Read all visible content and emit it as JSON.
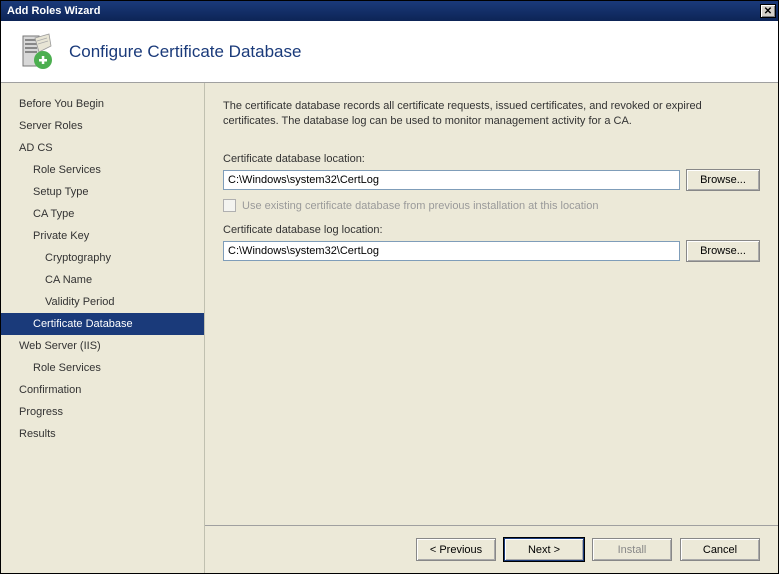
{
  "window": {
    "title": "Add Roles Wizard"
  },
  "header": {
    "page_title": "Configure Certificate Database"
  },
  "sidebar": {
    "items": [
      {
        "label": "Before You Begin",
        "indent": 0,
        "selected": false
      },
      {
        "label": "Server Roles",
        "indent": 0,
        "selected": false
      },
      {
        "label": "AD CS",
        "indent": 0,
        "selected": false
      },
      {
        "label": "Role Services",
        "indent": 1,
        "selected": false
      },
      {
        "label": "Setup Type",
        "indent": 1,
        "selected": false
      },
      {
        "label": "CA Type",
        "indent": 1,
        "selected": false
      },
      {
        "label": "Private Key",
        "indent": 1,
        "selected": false
      },
      {
        "label": "Cryptography",
        "indent": 2,
        "selected": false
      },
      {
        "label": "CA Name",
        "indent": 2,
        "selected": false
      },
      {
        "label": "Validity Period",
        "indent": 2,
        "selected": false
      },
      {
        "label": "Certificate Database",
        "indent": 1,
        "selected": true
      },
      {
        "label": "Web Server (IIS)",
        "indent": 0,
        "selected": false
      },
      {
        "label": "Role Services",
        "indent": 1,
        "selected": false
      },
      {
        "label": "Confirmation",
        "indent": 0,
        "selected": false
      },
      {
        "label": "Progress",
        "indent": 0,
        "selected": false
      },
      {
        "label": "Results",
        "indent": 0,
        "selected": false
      }
    ]
  },
  "content": {
    "description": "The certificate database records all certificate requests, issued certificates, and revoked or expired certificates. The database log can be used to monitor management activity for a CA.",
    "db_location_label": "Certificate database location:",
    "db_location_value": "C:\\Windows\\system32\\CertLog",
    "browse1_label": "Browse...",
    "checkbox_label": "Use existing certificate database from previous installation at this location",
    "checkbox_checked": false,
    "checkbox_enabled": false,
    "log_location_label": "Certificate database log location:",
    "log_location_value": "C:\\Windows\\system32\\CertLog",
    "browse2_label": "Browse..."
  },
  "footer": {
    "previous": "< Previous",
    "next": "Next >",
    "install": "Install",
    "install_enabled": false,
    "cancel": "Cancel"
  }
}
